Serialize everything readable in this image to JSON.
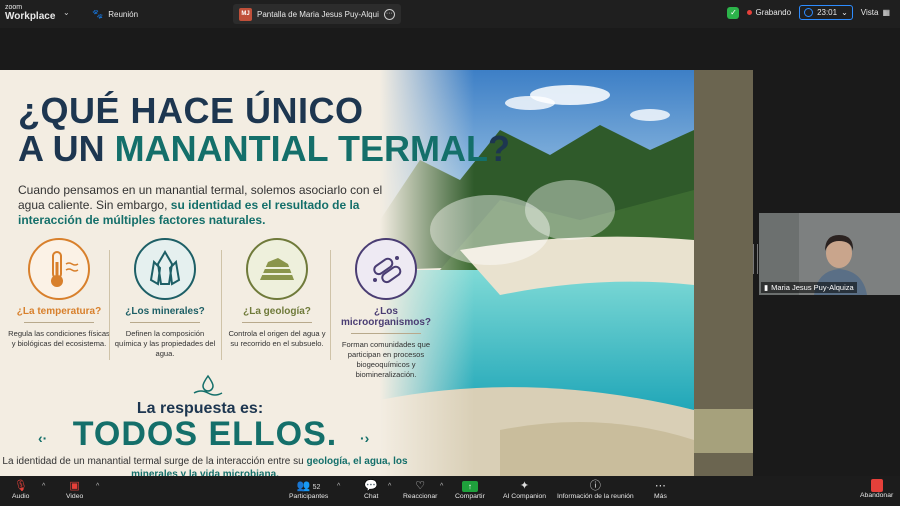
{
  "app": {
    "logo_top": "zoom",
    "logo_bottom": "Workplace"
  },
  "topbar": {
    "meeting_label": "Reunión",
    "share_initials": "MJ",
    "share_title": "Pantalla de Maria Jesus Puy-Alqui",
    "recording_label": "Grabando",
    "timer": "23:01",
    "view_label": "Vista"
  },
  "slide": {
    "title_line1": "¿QUÉ HACE ÚNICO",
    "title_line2_prefix": "A UN ",
    "title_line2_highlight": "MANANTIAL TERMAL",
    "title_line2_suffix": "?",
    "intro_plain": "Cuando pensamos en un manantial termal, solemos asociarlo con el agua caliente. Sin embargo, ",
    "intro_bold": "su identidad es el resultado de la interacción de múltiples factores naturales.",
    "factors": [
      {
        "icon": "thermometer-icon",
        "color": "#d8802c",
        "question": "¿La temperatura?",
        "desc": "Regula las condiciones físicas y biológicas del ecosistema."
      },
      {
        "icon": "crystal-icon",
        "color": "#1d5f66",
        "question": "¿Los minerales?",
        "desc": "Definen la composición química y las propiedades del agua."
      },
      {
        "icon": "rock-layers-icon",
        "color": "#6f7a3a",
        "question": "¿La geología?",
        "desc": "Controla el origen del agua y su recorrido en el subsuelo."
      },
      {
        "icon": "microbe-icon",
        "color": "#4a3d73",
        "question": "¿Los microorganismos?",
        "desc": "Forman comunidades que participan en procesos biogeoquímicos y biomineralización."
      }
    ],
    "answer_intro": "La respuesta es:",
    "answer_main": "TODOS ELLOS.",
    "closing_plain": "La identidad de un manantial termal surge de la interacción entre su ",
    "closing_bold": "geología, el agua, los minerales y la vida microbiana."
  },
  "participant": {
    "name": "Maria Jesus Puy-Alquiza"
  },
  "toolbar": {
    "audio": "Audio",
    "video": "Video",
    "participants": "Participantes",
    "participants_count": "52",
    "chat": "Chat",
    "react": "Reaccionar",
    "share": "Compartir",
    "ai": "AI Companion",
    "info": "Información de la reunión",
    "more": "Más",
    "leave": "Abandonar"
  }
}
